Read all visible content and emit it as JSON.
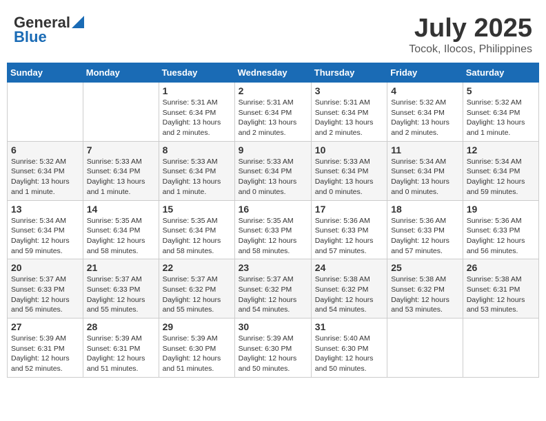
{
  "header": {
    "logo_general": "General",
    "logo_blue": "Blue",
    "month_title": "July 2025",
    "location": "Tocok, Ilocos, Philippines"
  },
  "calendar": {
    "days_of_week": [
      "Sunday",
      "Monday",
      "Tuesday",
      "Wednesday",
      "Thursday",
      "Friday",
      "Saturday"
    ],
    "weeks": [
      [
        {
          "day": "",
          "info": ""
        },
        {
          "day": "",
          "info": ""
        },
        {
          "day": "1",
          "info": "Sunrise: 5:31 AM\nSunset: 6:34 PM\nDaylight: 13 hours and 2 minutes."
        },
        {
          "day": "2",
          "info": "Sunrise: 5:31 AM\nSunset: 6:34 PM\nDaylight: 13 hours and 2 minutes."
        },
        {
          "day": "3",
          "info": "Sunrise: 5:31 AM\nSunset: 6:34 PM\nDaylight: 13 hours and 2 minutes."
        },
        {
          "day": "4",
          "info": "Sunrise: 5:32 AM\nSunset: 6:34 PM\nDaylight: 13 hours and 2 minutes."
        },
        {
          "day": "5",
          "info": "Sunrise: 5:32 AM\nSunset: 6:34 PM\nDaylight: 13 hours and 1 minute."
        }
      ],
      [
        {
          "day": "6",
          "info": "Sunrise: 5:32 AM\nSunset: 6:34 PM\nDaylight: 13 hours and 1 minute."
        },
        {
          "day": "7",
          "info": "Sunrise: 5:33 AM\nSunset: 6:34 PM\nDaylight: 13 hours and 1 minute."
        },
        {
          "day": "8",
          "info": "Sunrise: 5:33 AM\nSunset: 6:34 PM\nDaylight: 13 hours and 1 minute."
        },
        {
          "day": "9",
          "info": "Sunrise: 5:33 AM\nSunset: 6:34 PM\nDaylight: 13 hours and 0 minutes."
        },
        {
          "day": "10",
          "info": "Sunrise: 5:33 AM\nSunset: 6:34 PM\nDaylight: 13 hours and 0 minutes."
        },
        {
          "day": "11",
          "info": "Sunrise: 5:34 AM\nSunset: 6:34 PM\nDaylight: 13 hours and 0 minutes."
        },
        {
          "day": "12",
          "info": "Sunrise: 5:34 AM\nSunset: 6:34 PM\nDaylight: 12 hours and 59 minutes."
        }
      ],
      [
        {
          "day": "13",
          "info": "Sunrise: 5:34 AM\nSunset: 6:34 PM\nDaylight: 12 hours and 59 minutes."
        },
        {
          "day": "14",
          "info": "Sunrise: 5:35 AM\nSunset: 6:34 PM\nDaylight: 12 hours and 58 minutes."
        },
        {
          "day": "15",
          "info": "Sunrise: 5:35 AM\nSunset: 6:34 PM\nDaylight: 12 hours and 58 minutes."
        },
        {
          "day": "16",
          "info": "Sunrise: 5:35 AM\nSunset: 6:33 PM\nDaylight: 12 hours and 58 minutes."
        },
        {
          "day": "17",
          "info": "Sunrise: 5:36 AM\nSunset: 6:33 PM\nDaylight: 12 hours and 57 minutes."
        },
        {
          "day": "18",
          "info": "Sunrise: 5:36 AM\nSunset: 6:33 PM\nDaylight: 12 hours and 57 minutes."
        },
        {
          "day": "19",
          "info": "Sunrise: 5:36 AM\nSunset: 6:33 PM\nDaylight: 12 hours and 56 minutes."
        }
      ],
      [
        {
          "day": "20",
          "info": "Sunrise: 5:37 AM\nSunset: 6:33 PM\nDaylight: 12 hours and 56 minutes."
        },
        {
          "day": "21",
          "info": "Sunrise: 5:37 AM\nSunset: 6:33 PM\nDaylight: 12 hours and 55 minutes."
        },
        {
          "day": "22",
          "info": "Sunrise: 5:37 AM\nSunset: 6:32 PM\nDaylight: 12 hours and 55 minutes."
        },
        {
          "day": "23",
          "info": "Sunrise: 5:37 AM\nSunset: 6:32 PM\nDaylight: 12 hours and 54 minutes."
        },
        {
          "day": "24",
          "info": "Sunrise: 5:38 AM\nSunset: 6:32 PM\nDaylight: 12 hours and 54 minutes."
        },
        {
          "day": "25",
          "info": "Sunrise: 5:38 AM\nSunset: 6:32 PM\nDaylight: 12 hours and 53 minutes."
        },
        {
          "day": "26",
          "info": "Sunrise: 5:38 AM\nSunset: 6:31 PM\nDaylight: 12 hours and 53 minutes."
        }
      ],
      [
        {
          "day": "27",
          "info": "Sunrise: 5:39 AM\nSunset: 6:31 PM\nDaylight: 12 hours and 52 minutes."
        },
        {
          "day": "28",
          "info": "Sunrise: 5:39 AM\nSunset: 6:31 PM\nDaylight: 12 hours and 51 minutes."
        },
        {
          "day": "29",
          "info": "Sunrise: 5:39 AM\nSunset: 6:30 PM\nDaylight: 12 hours and 51 minutes."
        },
        {
          "day": "30",
          "info": "Sunrise: 5:39 AM\nSunset: 6:30 PM\nDaylight: 12 hours and 50 minutes."
        },
        {
          "day": "31",
          "info": "Sunrise: 5:40 AM\nSunset: 6:30 PM\nDaylight: 12 hours and 50 minutes."
        },
        {
          "day": "",
          "info": ""
        },
        {
          "day": "",
          "info": ""
        }
      ]
    ]
  }
}
